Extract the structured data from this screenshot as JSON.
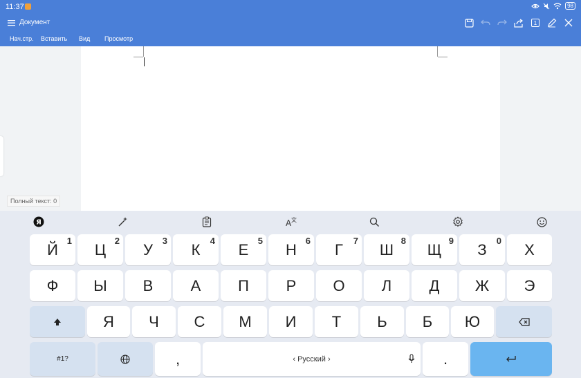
{
  "status_bar": {
    "time": "11:37",
    "battery": "98"
  },
  "app": {
    "title": "Документ",
    "tabs": [
      "Нач.стр.",
      "Вставить",
      "Вид",
      "Просмотр"
    ],
    "page_indicator": "1"
  },
  "document": {
    "word_count": "Полный текст: 0"
  },
  "keyboard": {
    "row1": [
      {
        "label": "Й",
        "hint": "1"
      },
      {
        "label": "Ц",
        "hint": "2"
      },
      {
        "label": "У",
        "hint": "3"
      },
      {
        "label": "К",
        "hint": "4"
      },
      {
        "label": "Е",
        "hint": "5"
      },
      {
        "label": "Н",
        "hint": "6"
      },
      {
        "label": "Г",
        "hint": "7"
      },
      {
        "label": "Ш",
        "hint": "8"
      },
      {
        "label": "Щ",
        "hint": "9"
      },
      {
        "label": "З",
        "hint": "0"
      },
      {
        "label": "Х",
        "hint": ""
      }
    ],
    "row2": [
      "Ф",
      "Ы",
      "В",
      "А",
      "П",
      "Р",
      "О",
      "Л",
      "Д",
      "Ж",
      "Э"
    ],
    "row3": [
      "Я",
      "Ч",
      "С",
      "М",
      "И",
      "Т",
      "Ь",
      "Б",
      "Ю"
    ],
    "symbols_label": "#1?",
    "comma": ",",
    "period": ".",
    "space_label": "‹ Русский ›",
    "toolbar_icons": [
      "yandex-icon",
      "magic-wand-icon",
      "clipboard-icon",
      "translate-icon",
      "search-icon",
      "settings-icon",
      "emoji-icon"
    ]
  }
}
